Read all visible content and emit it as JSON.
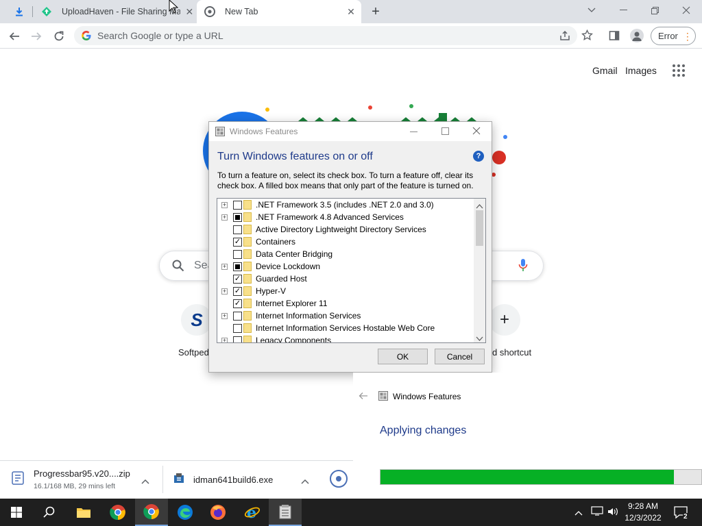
{
  "browser": {
    "tabs": [
      {
        "title": "UploadHaven - File Sharing Ma"
      },
      {
        "title": "New Tab"
      }
    ],
    "omnibox_placeholder": "Search Google or type a URL",
    "error_label": "Error"
  },
  "ntp": {
    "gmail": "Gmail",
    "images": "Images",
    "search_partial": "Sea",
    "shortcut_left_label": "Softped",
    "shortcut_right_label": "d shortcut",
    "shortcut_left_letter": "S"
  },
  "windows_features": {
    "title": "Windows Features",
    "heading": "Turn Windows features on or off",
    "description": "To turn a feature on, select its check box. To turn a feature off, clear its check box. A filled box means that only part of the feature is turned on.",
    "features": [
      {
        "label": ".NET Framework 3.5 (includes .NET 2.0 and 3.0)",
        "state": "unchecked",
        "expandable": true
      },
      {
        "label": ".NET Framework 4.8 Advanced Services",
        "state": "partial",
        "expandable": true
      },
      {
        "label": "Active Directory Lightweight Directory Services",
        "state": "unchecked",
        "expandable": false
      },
      {
        "label": "Containers",
        "state": "checked",
        "expandable": false
      },
      {
        "label": "Data Center Bridging",
        "state": "unchecked",
        "expandable": false
      },
      {
        "label": "Device Lockdown",
        "state": "partial",
        "expandable": true
      },
      {
        "label": "Guarded Host",
        "state": "checked",
        "expandable": false
      },
      {
        "label": "Hyper-V",
        "state": "checked",
        "expandable": true
      },
      {
        "label": "Internet Explorer 11",
        "state": "checked",
        "expandable": false
      },
      {
        "label": "Internet Information Services",
        "state": "unchecked",
        "expandable": true
      },
      {
        "label": "Internet Information Services Hostable Web Core",
        "state": "unchecked",
        "expandable": false
      },
      {
        "label": "Legacy Components",
        "state": "unchecked",
        "expandable": true
      }
    ],
    "ok_label": "OK",
    "cancel_label": "Cancel"
  },
  "applying_window": {
    "title": "Windows Features",
    "heading": "Applying changes",
    "progress_fraction": 0.915
  },
  "downloads": [
    {
      "name": "Progressbar95.v20....zip",
      "status": "16.1/168 MB, 29 mins left"
    },
    {
      "name": "idman641build6.exe",
      "status": ""
    }
  ],
  "taskbar": {
    "time": "9:28 AM",
    "date": "12/3/2022",
    "notification_count": "2"
  }
}
